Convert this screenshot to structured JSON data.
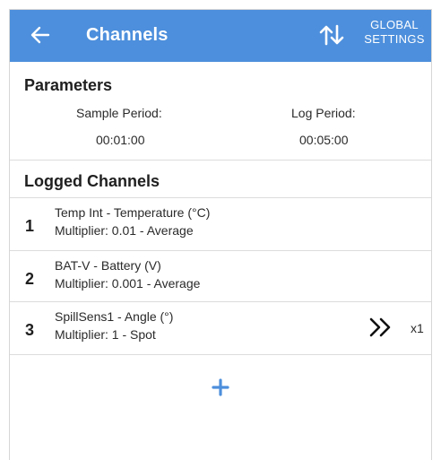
{
  "appbar": {
    "title": "Channels",
    "global_settings_line1": "GLOBAL",
    "global_settings_line2": "SETTINGS",
    "color": "#4d8fdc",
    "icons": [
      "arrow-back-icon",
      "sort-icon"
    ]
  },
  "parameters": {
    "header": "Parameters",
    "sample_period_label": "Sample Period:",
    "sample_period_value": "00:01:00",
    "log_period_label": "Log Period:",
    "log_period_value": "00:05:00"
  },
  "logged_channels": {
    "header": "Logged Channels",
    "items": [
      {
        "index": "1",
        "name": "Temp Int - Temperature (°C)",
        "detail": "Multiplier: 0.01 - Average"
      },
      {
        "index": "2",
        "name": "BAT-V - Battery (V)",
        "detail": "Multiplier: 0.001 - Average"
      },
      {
        "index": "3",
        "name": "SpillSens1 - Angle (°)",
        "detail": "Multiplier: 1 - Spot",
        "multiplier_badge": "x1",
        "icon": "double-chevron-right-icon"
      }
    ]
  },
  "add_button": {
    "icon": "plus-icon",
    "color": "#4d8fdc"
  }
}
